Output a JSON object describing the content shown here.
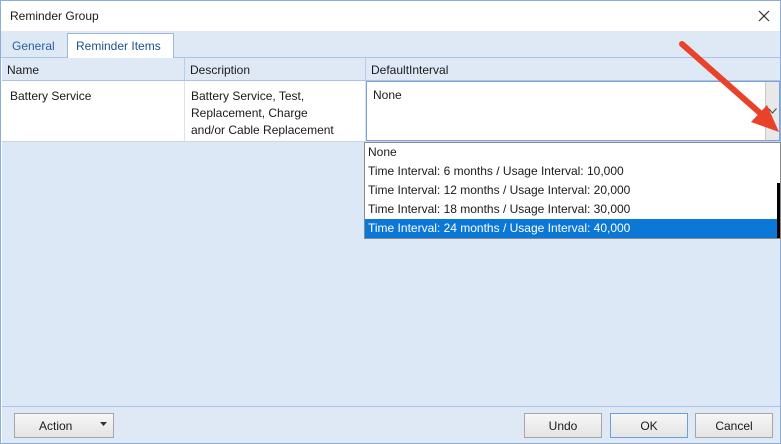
{
  "window": {
    "title": "Reminder Group"
  },
  "tabs": [
    {
      "label": "General"
    },
    {
      "label": "Reminder Items"
    }
  ],
  "grid": {
    "columns": [
      "Name",
      "Description",
      "DefaultInterval"
    ],
    "rows": [
      {
        "name": "Battery Service",
        "description_lines": [
          "Battery Service, Test,",
          "Replacement, Charge",
          "and/or Cable Replacement"
        ],
        "default_interval": "None"
      }
    ]
  },
  "dropdown": {
    "options": [
      "None",
      "Time Interval: 6 months / Usage Interval: 10,000",
      "Time Interval: 12 months / Usage Interval: 20,000",
      "Time Interval: 18 months / Usage Interval: 30,000",
      "Time Interval: 24 months / Usage Interval: 40,000"
    ],
    "selected_index": 4
  },
  "footer": {
    "action_label": "Action",
    "undo_label": "Undo",
    "ok_label": "OK",
    "cancel_label": "Cancel"
  },
  "colors": {
    "selection": "#0b78d7",
    "chrome": "#dfe9f6",
    "annotation_arrow": "#e8432a"
  }
}
